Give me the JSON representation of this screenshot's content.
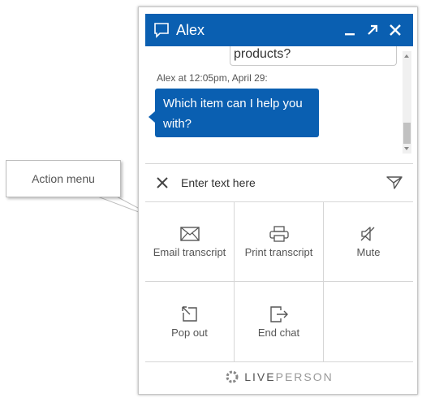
{
  "callout": {
    "text": "Action menu"
  },
  "window": {
    "title": "Alex",
    "accent_color": "#0a5fb1",
    "actions": [
      "minimize-icon",
      "popout-icon",
      "close-icon"
    ]
  },
  "chat": {
    "previous_message_tail": "products?",
    "meta": "Alex at 12:05pm, April 29:",
    "message": "Which item can I help you with?"
  },
  "input": {
    "placeholder": "Enter text here",
    "clear_icon": "close-icon",
    "send_icon": "send-icon"
  },
  "menu": {
    "items": [
      {
        "label": "Email transcript",
        "icon": "envelope-icon"
      },
      {
        "label": "Print transcript",
        "icon": "printer-icon"
      },
      {
        "label": "Mute",
        "icon": "speaker-mute-icon"
      },
      {
        "label": "Pop out",
        "icon": "popout-icon"
      },
      {
        "label": "End chat",
        "icon": "exit-icon"
      }
    ]
  },
  "footer": {
    "brand_strong": "LIVE",
    "brand_light": "PERSON"
  }
}
